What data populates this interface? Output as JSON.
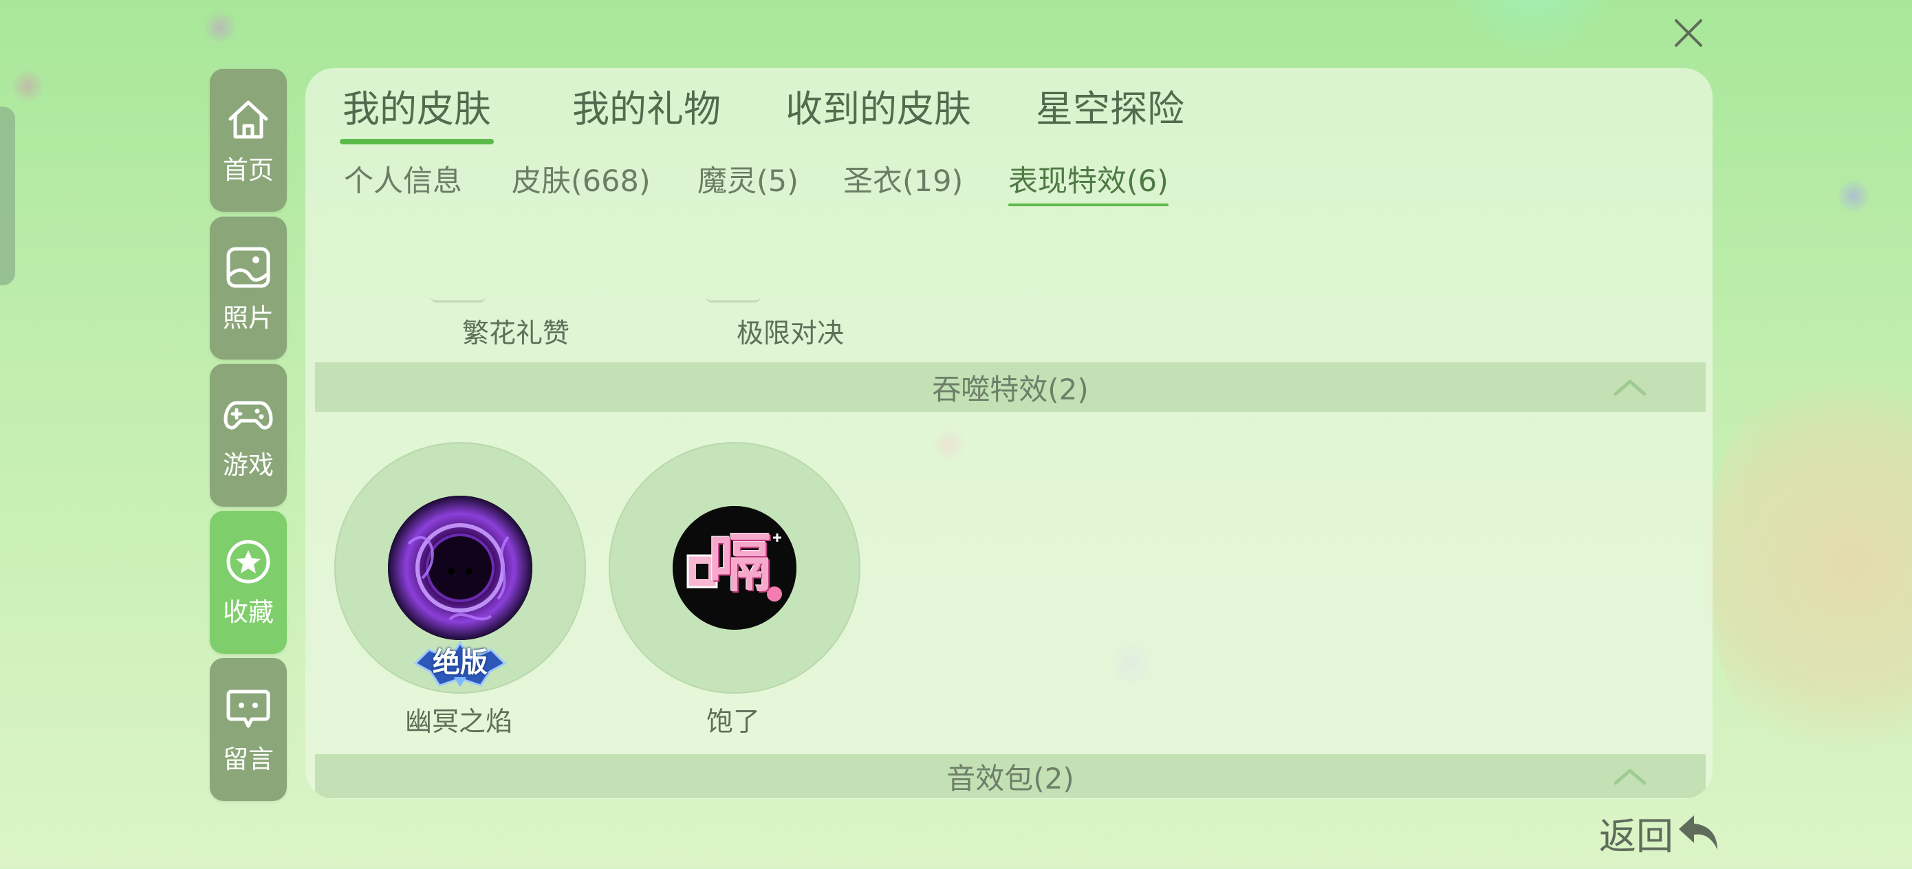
{
  "sidebar": {
    "items": [
      {
        "label": "首页",
        "icon": "home-icon"
      },
      {
        "label": "照片",
        "icon": "photo-icon"
      },
      {
        "label": "游戏",
        "icon": "gamepad-icon"
      },
      {
        "label": "收藏",
        "icon": "star-icon",
        "active": true
      },
      {
        "label": "留言",
        "icon": "message-icon"
      }
    ]
  },
  "main_tabs": [
    {
      "label": "我的皮肤",
      "active": true
    },
    {
      "label": "我的礼物"
    },
    {
      "label": "收到的皮肤"
    },
    {
      "label": "星空探险"
    }
  ],
  "sub_tabs": [
    {
      "label": "个人信息"
    },
    {
      "label": "皮肤(668)"
    },
    {
      "label": "魔灵(5)"
    },
    {
      "label": "圣衣(19)"
    },
    {
      "label": "表现特效(6)",
      "active": true
    }
  ],
  "previous_items": [
    {
      "label": "繁花礼赞"
    },
    {
      "label": "极限对决"
    }
  ],
  "sections": [
    {
      "title": "吞噬特效(2)",
      "collapse_icon": "chevron-up-icon",
      "items": [
        {
          "label": "幽冥之焰",
          "badge": "绝版"
        },
        {
          "label": "饱了",
          "art_text": "嗝"
        }
      ]
    },
    {
      "title": "音效包(2)",
      "collapse_icon": "chevron-up-icon"
    }
  ],
  "footer": {
    "return_label": "返回"
  },
  "colors": {
    "accent_green": "#5dbb4c",
    "sidebar_bg": "#8ba77a",
    "sidebar_active_bg": "#7ece6c",
    "section_header_bg": "#c4e1b5"
  }
}
